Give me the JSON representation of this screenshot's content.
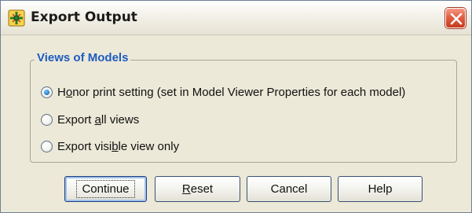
{
  "window": {
    "title": "Export Output",
    "icon": "spss-output-icon",
    "close_icon": "close-icon"
  },
  "group": {
    "label": "Views of Models"
  },
  "options": [
    {
      "label": "Honor print setting (set in Model Viewer Properties for each model)",
      "mnemonic": "o",
      "selected": true
    },
    {
      "label": "Export all views",
      "mnemonic": "a",
      "selected": false
    },
    {
      "label": "Export visible view only",
      "mnemonic": "b",
      "selected": false
    }
  ],
  "buttons": {
    "continue": "Continue",
    "reset": "Reset",
    "cancel": "Cancel",
    "help": "Help"
  },
  "colors": {
    "dialog_bg": "#ece9d8",
    "group_label": "#1d5cc0",
    "close_button": "#e35f42"
  }
}
